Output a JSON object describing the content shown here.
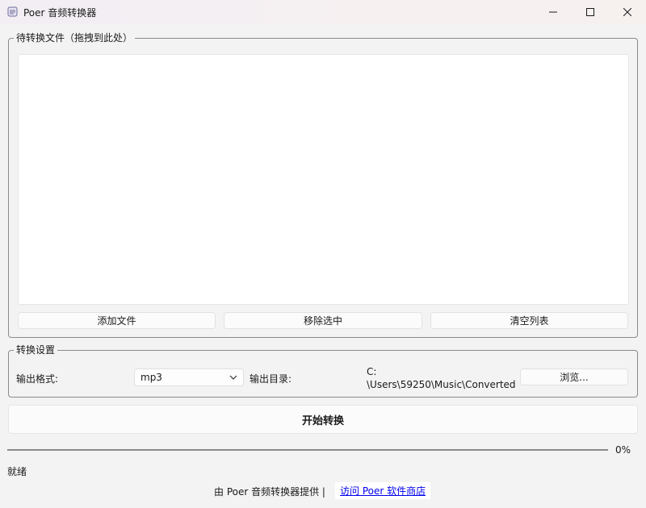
{
  "window": {
    "title": "Poer 音频转换器",
    "icon": "app-icon"
  },
  "files_group": {
    "label": "待转换文件（拖拽到此处）",
    "items": [],
    "add_button": "添加文件",
    "remove_button": "移除选中",
    "clear_button": "清空列表"
  },
  "settings": {
    "label": "转换设置",
    "format_label": "输出格式:",
    "format_value": "mp3",
    "outdir_label": "输出目录:",
    "outdir_value": "C:\n\\Users\\59250\\Music\\Converted",
    "browse_button": "浏览..."
  },
  "start_button": "开始转换",
  "progress": {
    "value": 0,
    "text": "0%"
  },
  "status": "就绪",
  "footer": {
    "text": "由 Poer 音频转换器提供 |",
    "link": "访问 Poer 软件商店"
  },
  "colors": {
    "accent": "#0067c0",
    "link": "#0000ee"
  }
}
